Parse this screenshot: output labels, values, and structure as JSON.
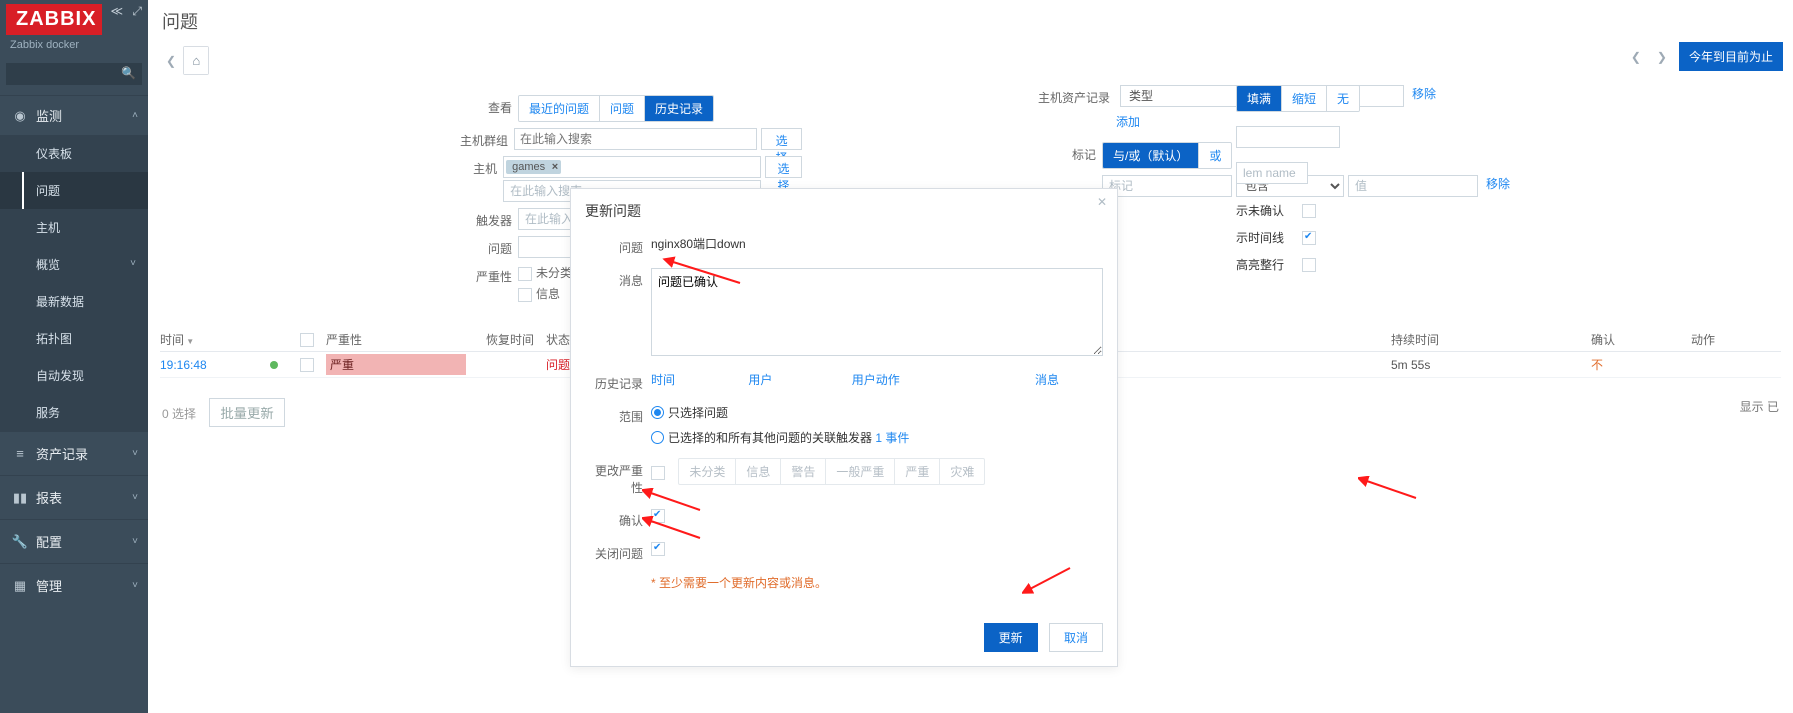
{
  "brand": {
    "logo": "ZABBIX",
    "subtitle": "Zabbix docker"
  },
  "sidebar": {
    "search_placeholder": "",
    "sections": [
      {
        "icon": "◉",
        "label": "监测",
        "open": true,
        "items": [
          {
            "label": "仪表板"
          },
          {
            "label": "问题",
            "active": true
          },
          {
            "label": "主机"
          },
          {
            "label": "概览",
            "chev": true
          },
          {
            "label": "最新数据"
          },
          {
            "label": "拓扑图"
          },
          {
            "label": "自动发现"
          },
          {
            "label": "服务"
          }
        ]
      },
      {
        "icon": "≡",
        "label": "资产记录"
      },
      {
        "icon": "▮▮",
        "label": "报表"
      },
      {
        "icon": "🔧",
        "label": "配置"
      },
      {
        "icon": "▦",
        "label": "管理"
      }
    ]
  },
  "page": {
    "title": "问题",
    "home_icon": "⌂",
    "nav_prev": "❮",
    "nav_next": "❯",
    "time_btn": "今年到目前为止"
  },
  "filter": {
    "labels": {
      "view": "查看",
      "hostgroup": "主机群组",
      "host": "主机",
      "trigger": "触发器",
      "problem": "问题",
      "severity": "严重性",
      "inventory": "主机资产记录",
      "type": "类型",
      "add": "添加",
      "remove": "移除",
      "tags": "标记",
      "tag_placeholder": "标记",
      "value_placeholder": "值",
      "contains": "包含"
    },
    "view_tabs": [
      "最近的问题",
      "问题",
      "历史记录"
    ],
    "view_active": 2,
    "hg_placeholder": "在此输入搜索",
    "host_tag": "games",
    "host_placeholder": "在此输入搜索",
    "trigger_placeholder": "在此输入搜...",
    "select_btn": "选择",
    "sev_items": [
      "未分类",
      "信息"
    ],
    "tag_modes": [
      "与/或（默认）",
      "或"
    ],
    "tag_mode_active": 0,
    "pills": [
      "填满",
      "缩短",
      "无"
    ],
    "pill_active": 0,
    "name_placeholder": "lem name",
    "opts": [
      {
        "label": "示未确认",
        "checked": false
      },
      {
        "label": "示时间线",
        "checked": true
      },
      {
        "label": "高亮整行",
        "checked": false
      }
    ]
  },
  "table": {
    "head": {
      "time": "时间",
      "sev": "严重性",
      "rec": "恢复时间",
      "status": "状态",
      "dur": "持续时间",
      "ack": "确认",
      "act": "动作"
    },
    "rows": [
      {
        "time": "19:16:48",
        "sev": "严重",
        "status": "问题",
        "dur": "5m 55s",
        "ack": "不"
      }
    ],
    "footer": {
      "selected": "0 选择",
      "bulk": "批量更新",
      "summary": "显示 已"
    }
  },
  "modal": {
    "title": "更新问题",
    "labels": {
      "problem": "问题",
      "message": "消息",
      "history": "历史记录",
      "scope": "范围",
      "change_sev": "更改严重性",
      "ack": "确认",
      "close": "关闭问题"
    },
    "problem_value": "nginx80端口down",
    "message_value": "问题已确认",
    "history_head": [
      "时间",
      "用户",
      "用户动作",
      "消息"
    ],
    "scope": {
      "opt1": "只选择问题",
      "opt2_prefix": "已选择的和所有其他问题的关联触发器 ",
      "opt2_link": "1 事件"
    },
    "sev_levels": [
      "未分类",
      "信息",
      "警告",
      "一般严重",
      "严重",
      "灾难"
    ],
    "ack_checked": true,
    "close_checked": true,
    "note": "* 至少需要一个更新内容或消息。",
    "btn_ok": "更新",
    "btn_cancel": "取消"
  }
}
